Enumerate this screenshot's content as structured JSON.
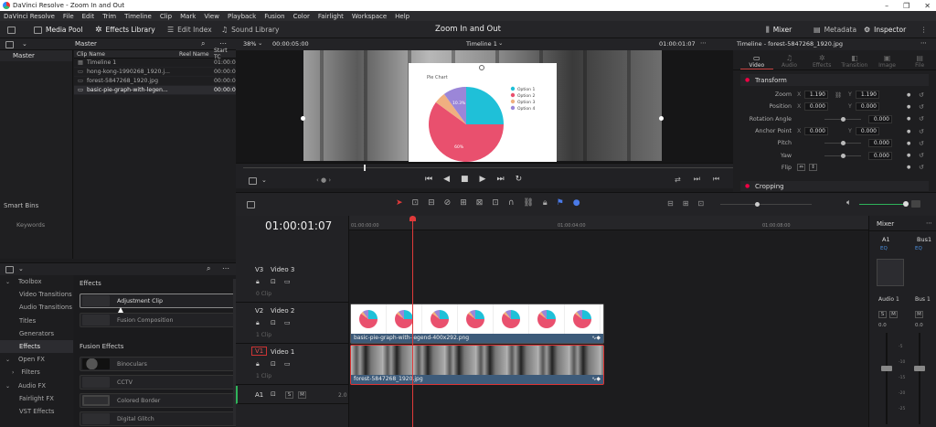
{
  "window": {
    "title": "DaVinci Resolve - Zoom In and Out"
  },
  "menu": [
    "DaVinci Resolve",
    "File",
    "Edit",
    "Trim",
    "Timeline",
    "Clip",
    "Mark",
    "View",
    "Playback",
    "Fusion",
    "Color",
    "Fairlight",
    "Workspace",
    "Help"
  ],
  "toolbar": {
    "media_pool": "Media Pool",
    "effects_library": "Effects Library",
    "edit_index": "Edit Index",
    "sound_library": "Sound Library",
    "project_title": "Zoom In and Out",
    "mixer": "Mixer",
    "metadata": "Metadata",
    "inspector": "Inspector"
  },
  "media_pool": {
    "bin": "Master",
    "bins": [
      "Master"
    ],
    "smart_bins": "Smart Bins",
    "keywords": "Keywords",
    "columns": {
      "name": "Clip Name",
      "reel": "Reel Name",
      "start": "Start TC"
    },
    "clips": [
      {
        "name": "Timeline 1",
        "tc": "01:00:0",
        "icon": "timeline-icon"
      },
      {
        "name": "hong-kong-1990268_1920.j...",
        "tc": "00:00:0",
        "icon": "image-icon"
      },
      {
        "name": "forest-5847268_1920.jpg",
        "tc": "00:00:0",
        "icon": "image-icon"
      },
      {
        "name": "basic-pie-graph-with-legen...",
        "tc": "00:00:0",
        "icon": "image-icon"
      }
    ]
  },
  "effects": {
    "tree": [
      {
        "label": "Toolbox",
        "level": 0
      },
      {
        "label": "Video Transitions",
        "level": 1
      },
      {
        "label": "Audio Transitions",
        "level": 1
      },
      {
        "label": "Titles",
        "level": 1
      },
      {
        "label": "Generators",
        "level": 1
      },
      {
        "label": "Effects",
        "level": 1,
        "selected": true
      },
      {
        "label": "Open FX",
        "level": 0
      },
      {
        "label": "Filters",
        "level": 1
      },
      {
        "label": "Audio FX",
        "level": 0
      },
      {
        "label": "Fairlight FX",
        "level": 1
      },
      {
        "label": "VST Effects",
        "level": 1
      }
    ],
    "section1": "Effects",
    "effects_items": [
      "Adjustment Clip",
      "Fusion Composition"
    ],
    "section2": "Fusion Effects",
    "fusion_items": [
      "Binoculars",
      "CCTV",
      "Colored Border",
      "Digital Glitch"
    ]
  },
  "viewer": {
    "zoom": "38%",
    "timecode_left": "00:00:05:00",
    "timeline_name": "Timeline 1",
    "timecode_right": "01:00:01:07",
    "chart_title": "Pie Chart"
  },
  "chart_data": {
    "type": "pie",
    "title": "Pie Chart",
    "labels": [
      "Option 1",
      "Option 2",
      "Option 3",
      "Option 4"
    ],
    "values": [
      25,
      60,
      5,
      10
    ],
    "data_labels": [
      "",
      "60%",
      "",
      "10.3%"
    ],
    "colors": [
      "#1fc0d8",
      "#e9506e",
      "#f0b080",
      "#9b86d8"
    ],
    "legend": "right"
  },
  "inspector": {
    "clip": "Timeline - forest-5847268_1920.jpg",
    "tabs": [
      "Video",
      "Audio",
      "Effects",
      "Transition",
      "Image",
      "File"
    ],
    "section": "Transform",
    "props": [
      {
        "name": "Zoom",
        "x": "1.190",
        "y": "1.190"
      },
      {
        "name": "Position",
        "x": "0.000",
        "y": "0.000"
      },
      {
        "name": "Rotation Angle",
        "v": "0.000"
      },
      {
        "name": "Anchor Point",
        "x": "0.000",
        "y": "0.000"
      },
      {
        "name": "Pitch",
        "v": "0.000"
      },
      {
        "name": "Yaw",
        "v": "0.000"
      },
      {
        "name": "Flip"
      }
    ],
    "section2": "Cropping"
  },
  "timeline": {
    "timecode": "01:00:01:07",
    "ruler": [
      "01:00:00:00",
      "01:00:04:00",
      "01:00:08:00"
    ],
    "tracks": [
      {
        "id": "V3",
        "name": "Video 3",
        "clips": "0 Clip"
      },
      {
        "id": "V2",
        "name": "Video 2",
        "clips": "1 Clip"
      },
      {
        "id": "V1",
        "name": "Video 1",
        "clips": "1 Clip"
      },
      {
        "id": "A1",
        "level": "2.0"
      }
    ],
    "clip_v2": "basic-pie-graph-with-legend-400x292.png",
    "clip_v1": "forest-5847268_1920.jpg"
  },
  "mixer": {
    "title": "Mixer",
    "channels": [
      "A1",
      "Bus1"
    ],
    "eq": "EQ",
    "audio_labels": [
      "Audio 1",
      "Bus 1"
    ],
    "levels": [
      "0.0",
      "0.0"
    ],
    "scale": [
      "-5",
      "-10",
      "-15",
      "-20",
      "-25"
    ]
  }
}
